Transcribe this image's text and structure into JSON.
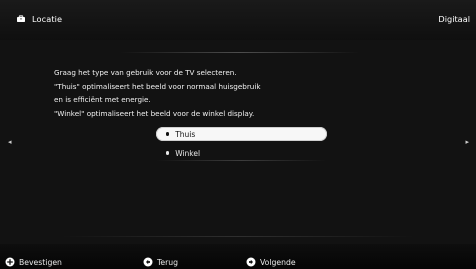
{
  "header": {
    "title": "Locatie",
    "source_label": "Digitaal",
    "icon": "briefcase-icon"
  },
  "content": {
    "description_lines": [
      "Graag het type van gebruik voor de TV selecteren.",
      "\"Thuis\" optimaliseert het beeld voor normaal huisgebruik",
      "en is efficiënt met energie.",
      "\"Winkel\" optimaliseert het beeld voor de winkel display."
    ],
    "options": [
      {
        "label": "Thuis",
        "selected": true
      },
      {
        "label": "Winkel",
        "selected": false
      }
    ],
    "left_arrow": "◂",
    "right_arrow": "▸"
  },
  "footer": {
    "hints": [
      {
        "label": "Bevestigen",
        "icon": "plus-circle-icon"
      },
      {
        "label": "Terug",
        "icon": "back-arrow-circle-icon"
      },
      {
        "label": "Volgende",
        "icon": "next-arrow-circle-icon"
      }
    ]
  },
  "colors": {
    "background": "#0b0b0b",
    "selected_fill": "#f7f7f7",
    "text": "#ffffff"
  }
}
